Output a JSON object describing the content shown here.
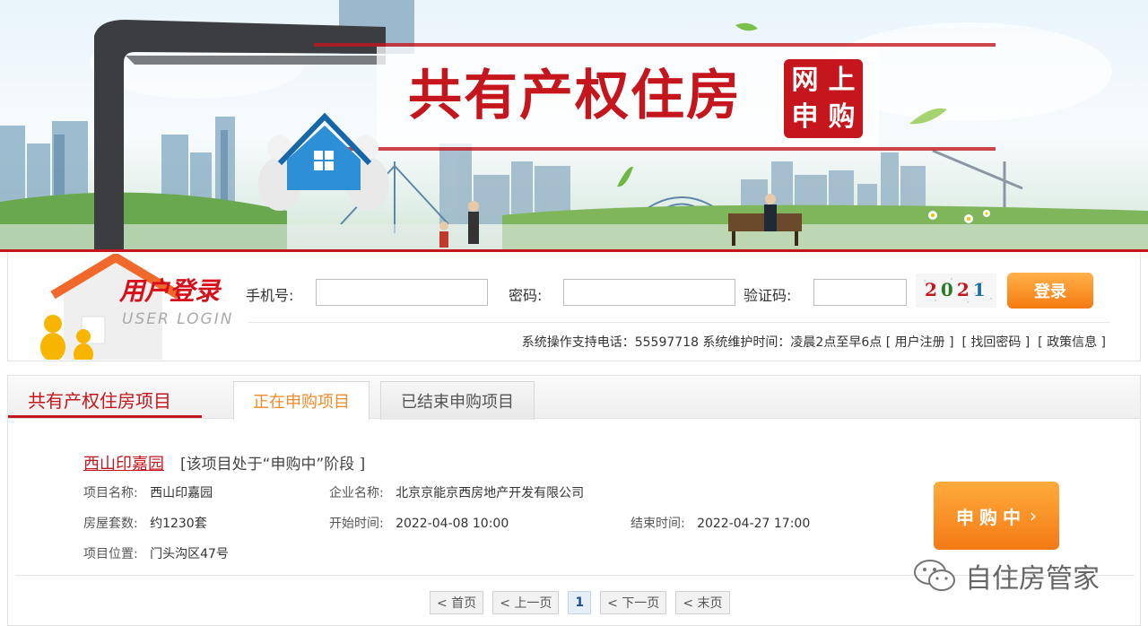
{
  "banner": {
    "title": "共有产权住房",
    "badge": [
      "网",
      "上",
      "申",
      "购"
    ]
  },
  "login": {
    "logo_title": "用户登录",
    "logo_sub": "USER LOGIN",
    "phone_label": "手机号:",
    "phone_value": "",
    "password_label": "密码:",
    "password_value": "",
    "captcha_label": "验证码:",
    "captcha_value": "",
    "captcha_image_text": [
      "2",
      "0",
      "2",
      "1"
    ],
    "captcha_colors": [
      "#c4161c",
      "#2a7a2a",
      "#c4161c",
      "#1a6fa0"
    ],
    "submit_label": "登录",
    "support_text": "系统操作支持电话：55597718 系统维护时间：凌晨2点至早6点",
    "link_register": "[ 用户注册 ]",
    "link_find_password": "[ 找回密码 ]",
    "link_policy": "[ 政策信息 ]"
  },
  "panel": {
    "title": "共有产权住房项目",
    "tabs": [
      {
        "label": "正在申购项目",
        "active": true
      },
      {
        "label": "已结束申购项目",
        "active": false
      }
    ]
  },
  "project": {
    "name_link": "西山印嘉园",
    "stage": "[该项目处于“申购中”阶段 ]",
    "fields": {
      "name_label": "项目名称:",
      "name_value": "西山印嘉园",
      "company_label": "企业名称:",
      "company_value": "北京京能京西房地产开发有限公司",
      "units_label": "房屋套数:",
      "units_value": "约1230套",
      "start_label": "开始时间:",
      "start_value": "2022-04-08 10:00",
      "end_label": "结束时间:",
      "end_value": "2022-04-27 17:00",
      "location_label": "项目位置:",
      "location_value": "门头沟区47号"
    },
    "status_button": "申购中",
    "status_chevron": "›"
  },
  "pager": {
    "first": "< 首页",
    "prev": "< 上一页",
    "current": "1",
    "next": "< 下一页",
    "last": "< 末页"
  },
  "watermark": {
    "text": "自住房管家",
    "icon": "wechat-icon"
  },
  "colors": {
    "brand_red": "#c4161c",
    "accent_orange": "#f47a14",
    "tab_active_text": "#f08a2a"
  }
}
